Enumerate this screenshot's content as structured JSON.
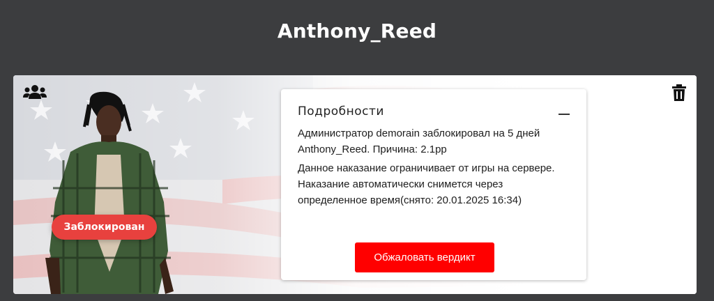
{
  "header": {
    "player_name": "Anthony_Reed"
  },
  "card": {
    "status_badge": "Заблокирован",
    "icons": {
      "left": "group-icon",
      "right": "trash-icon"
    },
    "details": {
      "title": "Подробности",
      "line1": "Администратор demorain заблокировал на 5 дней Anthony_Reed. Причина: 2.1рр",
      "line2": "Данное наказание ограничивает от игры на сервере. Наказание автоматически снимется через определенное время(снято: 20.01.2025 16:34)",
      "appeal_button": "Обжаловать вердикт"
    }
  },
  "colors": {
    "background": "#3c3d3f",
    "badge": "#e8413e",
    "button": "#ff0000"
  }
}
